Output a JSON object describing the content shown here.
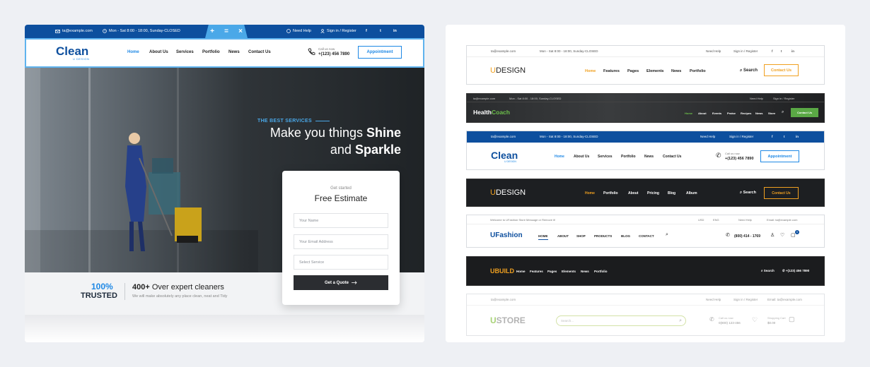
{
  "left_preview": {
    "topbar": {
      "email": "ta@example.com",
      "hours": "Mon - Sat 8:00 - 18:00, Sunday-CLOSED",
      "help": "Need Help",
      "signin": "Sign in / Register",
      "controls": [
        "+",
        "=",
        "×"
      ],
      "social": [
        "f",
        "t",
        "in"
      ]
    },
    "header": {
      "logo_main": "Clean",
      "logo_sub": "U DESIGN",
      "nav": [
        "Home",
        "About Us",
        "Services",
        "Portfolio",
        "News",
        "Contact Us"
      ],
      "active_nav": "Home",
      "call_label": "Call us now",
      "phone": "+(123) 456 7890",
      "cta": "Appointment"
    },
    "hero": {
      "kicker": "THE BEST SERVICES",
      "line1_light": "Make you things ",
      "line1_bold": "Shine",
      "line2_light": "and ",
      "line2_bold": "Sparkle"
    },
    "trust": {
      "percent": "100%",
      "trusted": "TRUSTED",
      "headline_bold": "400+",
      "headline_rest": " Over expert cleaners",
      "sub": "We will make absolutely any place clean, neat and Tidy"
    },
    "quote_form": {
      "kicker": "Get started",
      "title": "Free Estimate",
      "name_placeholder": "Your Name",
      "email_placeholder": "Your Email Address",
      "service_placeholder": "Select Service",
      "submit": "Get a Quote"
    }
  },
  "right_previews": {
    "udesign_light": {
      "email": "ta@example.com",
      "hours": "Mon - Sat 8:00 - 18:00, Sunday-CLOSED",
      "help": "Need Help",
      "signin": "Sign in / Register",
      "logo_u": "U",
      "logo_rest": "DESIGN",
      "nav": [
        "Home",
        "Features",
        "Pages",
        "Elements",
        "News",
        "Portfolio"
      ],
      "search": "Search",
      "cta": "Contact Us"
    },
    "healthcoach": {
      "email": "ta@example.com",
      "hours": "Mon - Sat 8:00 - 18:00, Sunday-CLOSED",
      "help": "Need Help",
      "signin": "Sign in / Register",
      "logo_a": "Health",
      "logo_b": "Coach",
      "nav": [
        "Home",
        "About",
        "Events",
        "Praise",
        "Recipes",
        "News",
        "Store"
      ],
      "cta": "Contact Us"
    },
    "clean": {
      "email": "ta@example.com",
      "hours": "Mon - Sat 8:00 - 18:00, Sunday-CLOSED",
      "help": "Need Help",
      "signin": "Sign in / Register",
      "logo_main": "Clean",
      "logo_sub": "U DESIGN",
      "nav": [
        "Home",
        "About Us",
        "Services",
        "Portfolio",
        "News",
        "Contact Us"
      ],
      "call_label": "Call us now",
      "phone": "+(123) 456 7890",
      "cta": "Appointment"
    },
    "udesign_dark": {
      "logo_u": "U",
      "logo_rest": "DESIGN",
      "nav": [
        "Home",
        "Portfolio",
        "About",
        "Pricing",
        "Blog",
        "Album"
      ],
      "search": "Search",
      "cta": "Contact Us"
    },
    "ufashion": {
      "welcome": "Welcome to UFashion Store Message or Remove it!",
      "currency": "USD",
      "language": "ENG",
      "help": "Need Help",
      "email": "Email: ta@example.com",
      "logo": "UFashion",
      "nav": [
        "HOME",
        "ABOUT",
        "SHOP",
        "PRODUCTS",
        "BLOG",
        "CONTACT"
      ],
      "phone": "(800) 414 - 1769",
      "cart_count": "0"
    },
    "ubuild": {
      "logo_u": "U",
      "logo_rest": "BUILD",
      "nav": [
        "Home",
        "Features",
        "Pages",
        "Elements",
        "News",
        "Portfolio"
      ],
      "search": "Search",
      "phone": "+(123) 456 7890"
    },
    "ustore": {
      "email": "ta@example.com",
      "help": "Need Help",
      "signin": "Sign in / Register",
      "email_right": "Email: ta@example.com",
      "logo_u": "U",
      "logo_rest": "STORE",
      "search_placeholder": "Search...",
      "call_label": "Call us now",
      "phone": "0(800) 123-456",
      "cart_label": "Shopping Cart",
      "cart_total": "$0.00"
    }
  },
  "colors": {
    "blue": "#0d4f9e",
    "accent_blue": "#1e88e5",
    "orange": "#f0a020",
    "green": "#4caf50",
    "dark": "#1d1f22"
  }
}
